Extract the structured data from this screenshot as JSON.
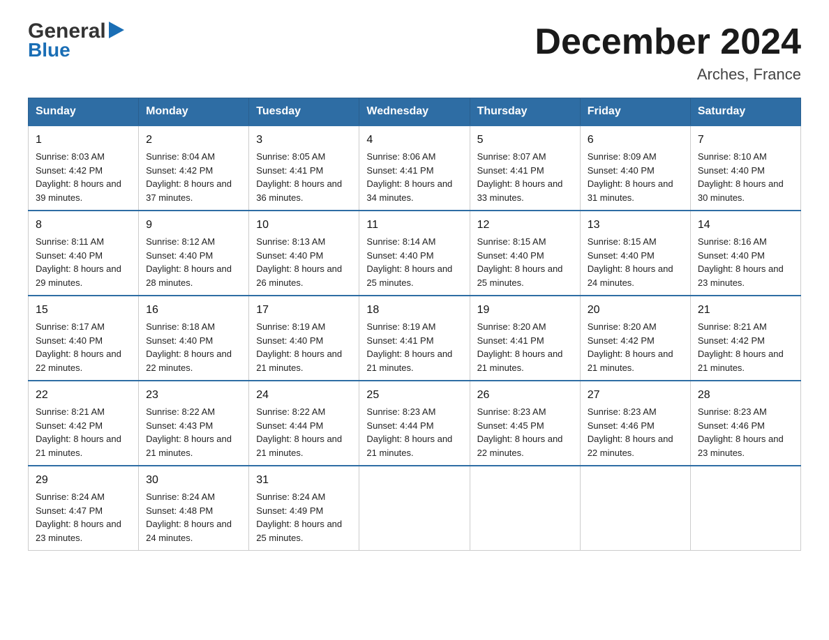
{
  "logo": {
    "line1_general": "General",
    "line1_arrow": "▶",
    "line2": "Blue"
  },
  "title": "December 2024",
  "location": "Arches, France",
  "days_of_week": [
    "Sunday",
    "Monday",
    "Tuesday",
    "Wednesday",
    "Thursday",
    "Friday",
    "Saturday"
  ],
  "weeks": [
    [
      {
        "day": "1",
        "sunrise": "8:03 AM",
        "sunset": "4:42 PM",
        "daylight": "8 hours and 39 minutes."
      },
      {
        "day": "2",
        "sunrise": "8:04 AM",
        "sunset": "4:42 PM",
        "daylight": "8 hours and 37 minutes."
      },
      {
        "day": "3",
        "sunrise": "8:05 AM",
        "sunset": "4:41 PM",
        "daylight": "8 hours and 36 minutes."
      },
      {
        "day": "4",
        "sunrise": "8:06 AM",
        "sunset": "4:41 PM",
        "daylight": "8 hours and 34 minutes."
      },
      {
        "day": "5",
        "sunrise": "8:07 AM",
        "sunset": "4:41 PM",
        "daylight": "8 hours and 33 minutes."
      },
      {
        "day": "6",
        "sunrise": "8:09 AM",
        "sunset": "4:40 PM",
        "daylight": "8 hours and 31 minutes."
      },
      {
        "day": "7",
        "sunrise": "8:10 AM",
        "sunset": "4:40 PM",
        "daylight": "8 hours and 30 minutes."
      }
    ],
    [
      {
        "day": "8",
        "sunrise": "8:11 AM",
        "sunset": "4:40 PM",
        "daylight": "8 hours and 29 minutes."
      },
      {
        "day": "9",
        "sunrise": "8:12 AM",
        "sunset": "4:40 PM",
        "daylight": "8 hours and 28 minutes."
      },
      {
        "day": "10",
        "sunrise": "8:13 AM",
        "sunset": "4:40 PM",
        "daylight": "8 hours and 26 minutes."
      },
      {
        "day": "11",
        "sunrise": "8:14 AM",
        "sunset": "4:40 PM",
        "daylight": "8 hours and 25 minutes."
      },
      {
        "day": "12",
        "sunrise": "8:15 AM",
        "sunset": "4:40 PM",
        "daylight": "8 hours and 25 minutes."
      },
      {
        "day": "13",
        "sunrise": "8:15 AM",
        "sunset": "4:40 PM",
        "daylight": "8 hours and 24 minutes."
      },
      {
        "day": "14",
        "sunrise": "8:16 AM",
        "sunset": "4:40 PM",
        "daylight": "8 hours and 23 minutes."
      }
    ],
    [
      {
        "day": "15",
        "sunrise": "8:17 AM",
        "sunset": "4:40 PM",
        "daylight": "8 hours and 22 minutes."
      },
      {
        "day": "16",
        "sunrise": "8:18 AM",
        "sunset": "4:40 PM",
        "daylight": "8 hours and 22 minutes."
      },
      {
        "day": "17",
        "sunrise": "8:19 AM",
        "sunset": "4:40 PM",
        "daylight": "8 hours and 21 minutes."
      },
      {
        "day": "18",
        "sunrise": "8:19 AM",
        "sunset": "4:41 PM",
        "daylight": "8 hours and 21 minutes."
      },
      {
        "day": "19",
        "sunrise": "8:20 AM",
        "sunset": "4:41 PM",
        "daylight": "8 hours and 21 minutes."
      },
      {
        "day": "20",
        "sunrise": "8:20 AM",
        "sunset": "4:42 PM",
        "daylight": "8 hours and 21 minutes."
      },
      {
        "day": "21",
        "sunrise": "8:21 AM",
        "sunset": "4:42 PM",
        "daylight": "8 hours and 21 minutes."
      }
    ],
    [
      {
        "day": "22",
        "sunrise": "8:21 AM",
        "sunset": "4:42 PM",
        "daylight": "8 hours and 21 minutes."
      },
      {
        "day": "23",
        "sunrise": "8:22 AM",
        "sunset": "4:43 PM",
        "daylight": "8 hours and 21 minutes."
      },
      {
        "day": "24",
        "sunrise": "8:22 AM",
        "sunset": "4:44 PM",
        "daylight": "8 hours and 21 minutes."
      },
      {
        "day": "25",
        "sunrise": "8:23 AM",
        "sunset": "4:44 PM",
        "daylight": "8 hours and 21 minutes."
      },
      {
        "day": "26",
        "sunrise": "8:23 AM",
        "sunset": "4:45 PM",
        "daylight": "8 hours and 22 minutes."
      },
      {
        "day": "27",
        "sunrise": "8:23 AM",
        "sunset": "4:46 PM",
        "daylight": "8 hours and 22 minutes."
      },
      {
        "day": "28",
        "sunrise": "8:23 AM",
        "sunset": "4:46 PM",
        "daylight": "8 hours and 23 minutes."
      }
    ],
    [
      {
        "day": "29",
        "sunrise": "8:24 AM",
        "sunset": "4:47 PM",
        "daylight": "8 hours and 23 minutes."
      },
      {
        "day": "30",
        "sunrise": "8:24 AM",
        "sunset": "4:48 PM",
        "daylight": "8 hours and 24 minutes."
      },
      {
        "day": "31",
        "sunrise": "8:24 AM",
        "sunset": "4:49 PM",
        "daylight": "8 hours and 25 minutes."
      },
      null,
      null,
      null,
      null
    ]
  ]
}
